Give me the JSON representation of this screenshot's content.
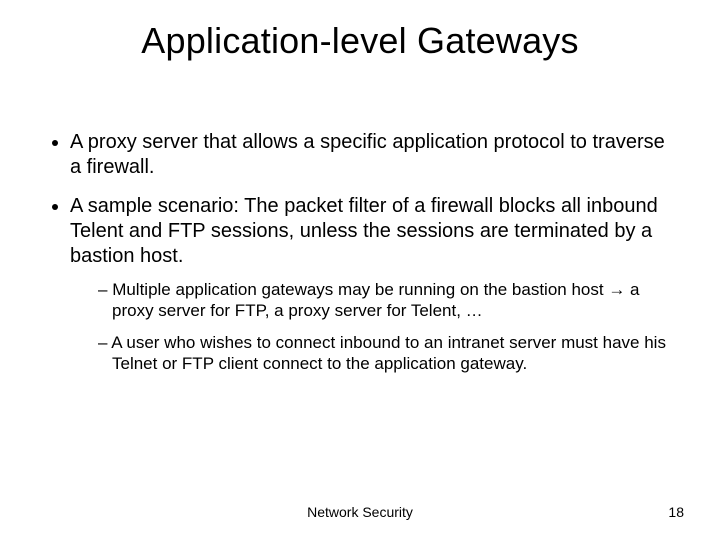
{
  "title": "Application-level Gateways",
  "bullets": [
    {
      "text": "A proxy server that allows a specific application protocol to traverse a firewall."
    },
    {
      "text": "A sample scenario: The packet filter of a firewall blocks all inbound Telent and FTP sessions, unless the sessions are terminated by a bastion host.",
      "sub": [
        {
          "pre": "Multiple application gateways may be running on the bastion host ",
          "arrow": "→",
          "post": " a proxy server for FTP, a proxy server for Telent, …"
        },
        {
          "pre": "A user who wishes to connect inbound to an intranet server must have his Telnet or FTP client connect to the application gateway.",
          "arrow": "",
          "post": ""
        }
      ]
    }
  ],
  "footer": {
    "center": "Network Security",
    "pageNumber": "18"
  }
}
